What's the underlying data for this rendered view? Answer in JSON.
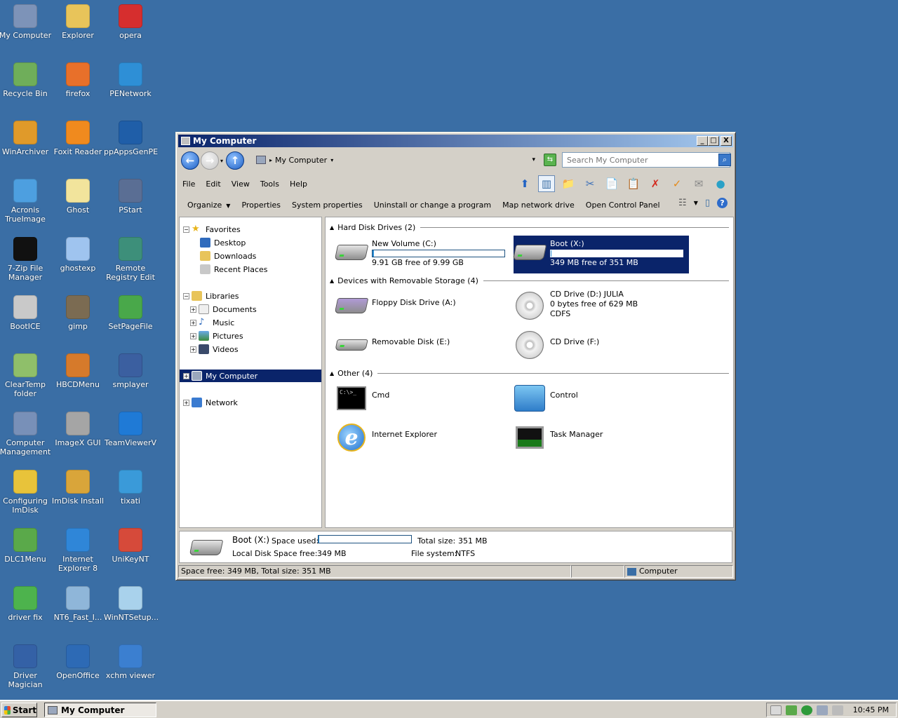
{
  "desktop": {
    "icons": [
      {
        "label": "My Computer",
        "icon": "computer-icon",
        "color": "#7d93b8"
      },
      {
        "label": "Explorer",
        "icon": "folder-icon",
        "color": "#e8c45a"
      },
      {
        "label": "opera",
        "icon": "opera-icon",
        "color": "#d62e2e"
      },
      {
        "label": "Recycle Bin",
        "icon": "recycle-bin-icon",
        "color": "#6fae5a"
      },
      {
        "label": "firefox",
        "icon": "firefox-icon",
        "color": "#e8702a"
      },
      {
        "label": "PENetwork",
        "icon": "network-globe-icon",
        "color": "#2e8fd6"
      },
      {
        "label": "WinArchiver",
        "icon": "archive-icon",
        "color": "#e09a2a"
      },
      {
        "label": "Foxit Reader",
        "icon": "pdf-icon",
        "color": "#f08a1e"
      },
      {
        "label": "ppAppsGenPE",
        "icon": "gear-globe-icon",
        "color": "#1f5ea8"
      },
      {
        "label": "Acronis TrueImage",
        "icon": "backup-icon",
        "color": "#4d9fe0"
      },
      {
        "label": "Ghost",
        "icon": "ghost-icon",
        "color": "#f2e49c"
      },
      {
        "label": "PStart",
        "icon": "play-icon",
        "color": "#5a6e94"
      },
      {
        "label": "7-Zip File Manager",
        "icon": "7zip-icon",
        "color": "#111111"
      },
      {
        "label": "ghostexp",
        "icon": "ghost-explorer-icon",
        "color": "#9fc4ef"
      },
      {
        "label": "Remote Registry Edit",
        "icon": "registry-icon",
        "color": "#3d8f7a"
      },
      {
        "label": "BootICE",
        "icon": "bootice-icon",
        "color": "#c9c9c9"
      },
      {
        "label": "gimp",
        "icon": "gimp-icon",
        "color": "#7b6b52"
      },
      {
        "label": "SetPageFile",
        "icon": "pagefile-icon",
        "color": "#49a84a"
      },
      {
        "label": "ClearTemp folder",
        "icon": "recycle-bin-icon",
        "color": "#8fbf6a"
      },
      {
        "label": "HBCDMenu",
        "icon": "tools-icon",
        "color": "#d67a2b"
      },
      {
        "label": "smplayer",
        "icon": "player-icon",
        "color": "#3b5fa0"
      },
      {
        "label": "Computer Management",
        "icon": "management-icon",
        "color": "#7890b8"
      },
      {
        "label": "ImageX GUI",
        "icon": "imagex-icon",
        "color": "#a5a5a5"
      },
      {
        "label": "TeamViewerV",
        "icon": "teamviewer-icon",
        "color": "#1f7ad6"
      },
      {
        "label": "Configuring ImDisk",
        "icon": "cd-icon",
        "color": "#e8c33a"
      },
      {
        "label": "ImDisk Install",
        "icon": "installer-icon",
        "color": "#d9a53a"
      },
      {
        "label": "tixati",
        "icon": "tixati-icon",
        "color": "#3a9ad9"
      },
      {
        "label": "DLC1Menu",
        "icon": "dlc-icon",
        "color": "#5aa94a"
      },
      {
        "label": "Internet Explorer 8",
        "icon": "ie-icon",
        "color": "#2f86d8"
      },
      {
        "label": "UniKeyNT",
        "icon": "keyboard-icon",
        "color": "#d64a3a"
      },
      {
        "label": "driver fix",
        "icon": "driver-fix-icon",
        "color": "#4db34d"
      },
      {
        "label": "NT6_Fast_I...",
        "icon": "nt6-icon",
        "color": "#8fb6d9"
      },
      {
        "label": "WinNTSetup...",
        "icon": "setup-icon",
        "color": "#a9d2ec"
      },
      {
        "label": "Driver Magician",
        "icon": "magician-icon",
        "color": "#3461a6"
      },
      {
        "label": "OpenOffice",
        "icon": "openoffice-icon",
        "color": "#2d6ab5"
      },
      {
        "label": "xchm viewer",
        "icon": "help-icon",
        "color": "#3b7fd0"
      }
    ]
  },
  "window": {
    "title": "My Computer",
    "minimize": "_",
    "maximize": "□",
    "close": "X",
    "back_glyph": "←",
    "forward_glyph": "→",
    "up_glyph": "↑",
    "address": "My Computer",
    "address_prefix": "▸",
    "address_caret": "▾",
    "go_glyph": "⇆",
    "search_placeholder": "Search My Computer",
    "search_glyph": "⌕",
    "menu": [
      "File",
      "Edit",
      "View",
      "Tools",
      "Help"
    ],
    "commands": [
      {
        "label": "Organize",
        "caret": "▼"
      },
      {
        "label": "Properties"
      },
      {
        "label": "System properties"
      },
      {
        "label": "Uninstall or change a program"
      },
      {
        "label": "Map network drive"
      },
      {
        "label": "Open Control Panel"
      }
    ],
    "toolbar_glyphs": [
      "⬆",
      "▥",
      "📁",
      "✂",
      "📄",
      "📋",
      "✗",
      "✓",
      "✉",
      "●"
    ],
    "cmd_right_glyphs": [
      "☷",
      "▼",
      "▯",
      "?"
    ],
    "tree": {
      "favorites": "Favorites",
      "desktop": "Desktop",
      "downloads": "Downloads",
      "recent": "Recent Places",
      "libraries": "Libraries",
      "documents": "Documents",
      "music": "Music",
      "pictures": "Pictures",
      "videos": "Videos",
      "computer": "My Computer",
      "network": "Network"
    },
    "groups": {
      "hdd": "Hard Disk Drives (2)",
      "removable": "Devices with Removable Storage (4)",
      "other": "Other (4)"
    },
    "items": {
      "c_name": "New Volume (C:)",
      "c_free": "9.91 GB free of 9.99 GB",
      "c_used_fraction": 0.008,
      "x_name": "Boot (X:)",
      "x_free": "349 MB free of 351 MB",
      "x_used_fraction": 0.006,
      "a_name": "Floppy Disk Drive (A:)",
      "d_name": "CD Drive (D:) JULIA",
      "d_free": "0 bytes free of 629 MB",
      "d_fs": "CDFS",
      "e_name": "Removable Disk (E:)",
      "f_name": "CD Drive (F:)",
      "cmd": "Cmd",
      "cmd_screen": "C:\\>_",
      "control": "Control",
      "ie": "Internet Explorer",
      "ie_glyph": "e",
      "taskmgr": "Task Manager"
    },
    "details": {
      "name": "Boot (X:)",
      "type": "Local Disk",
      "space_used_label": "Space used:",
      "space_free_label": "Space free:",
      "space_free": "349 MB",
      "total_label": "Total size:",
      "total": "351 MB",
      "fs_label": "File system:",
      "fs": "NTFS"
    },
    "status": {
      "left": "Space free: 349 MB, Total size: 351 MB",
      "right": "Computer"
    }
  },
  "taskbar": {
    "start": "Start",
    "task": "My Computer",
    "clock": "10:45 PM"
  }
}
